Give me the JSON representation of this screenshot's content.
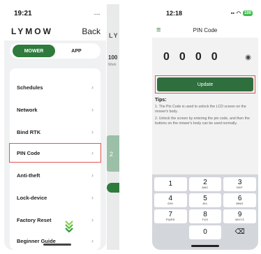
{
  "left": {
    "status": {
      "time": "19:21",
      "right": "..."
    },
    "header": {
      "logo": "LYMOW",
      "back": "Back"
    },
    "tabs": [
      "MOWER",
      "APP"
    ],
    "menu": [
      "Schedules",
      "Network",
      "Bind RTK",
      "PIN Code",
      "Anti-theft",
      "Lock-device",
      "Factory Reset",
      "Beginner Guide"
    ]
  },
  "peek": {
    "logo": "LY",
    "num": "100",
    "sub": "Work",
    "card": "2"
  },
  "right": {
    "status": {
      "time": "12:18",
      "battery": "100"
    },
    "title": "PIN Code",
    "pin": [
      "0",
      "0",
      "0",
      "0"
    ],
    "update": "Update",
    "tips_title": "Tips:",
    "tips": [
      "1. The Pin Code is used to unlock the LCD screen on the mower's body.",
      "2. Unlock the screen by entering the pin code, and then the buttons on the mower's body can be used normally."
    ],
    "keys": [
      [
        {
          "d": "1",
          "l": ""
        },
        {
          "d": "2",
          "l": "ABC"
        },
        {
          "d": "3",
          "l": "DEF"
        }
      ],
      [
        {
          "d": "4",
          "l": "GHI"
        },
        {
          "d": "5",
          "l": "JKL"
        },
        {
          "d": "6",
          "l": "MNO"
        }
      ],
      [
        {
          "d": "7",
          "l": "PQRS"
        },
        {
          "d": "8",
          "l": "TUV"
        },
        {
          "d": "9",
          "l": "WXYZ"
        }
      ],
      [
        {
          "d": "",
          "l": ""
        },
        {
          "d": "0",
          "l": ""
        },
        {
          "d": "⌫",
          "l": ""
        }
      ]
    ]
  },
  "colors": {
    "accent": "#2f7a3d",
    "highlight": "#e05555"
  }
}
